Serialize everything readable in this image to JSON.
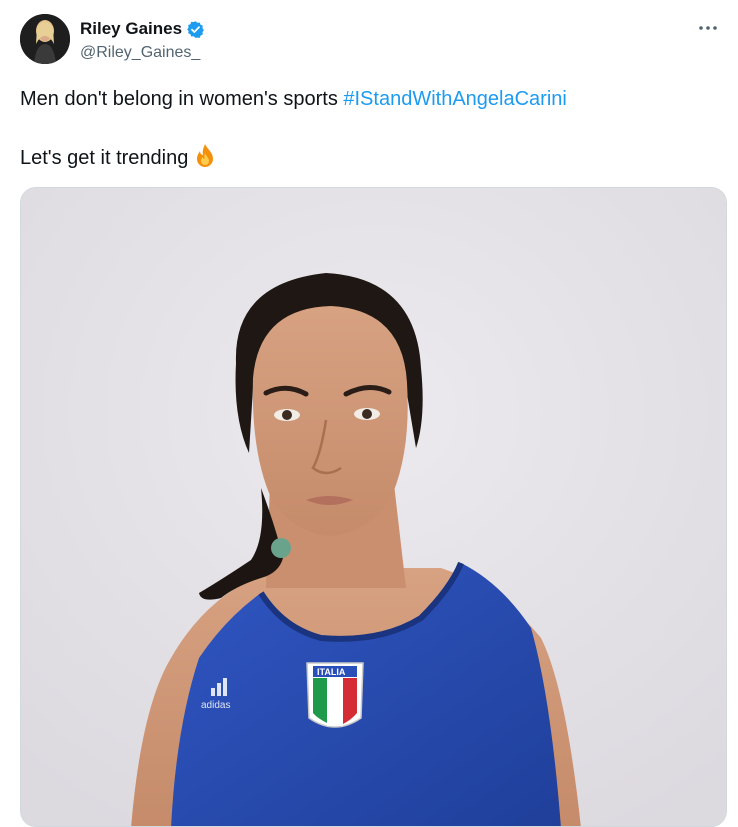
{
  "tweet": {
    "author": {
      "name": "Riley Gaines",
      "handle": "@Riley_Gaines_",
      "verified": true,
      "avatar": "profile-photo"
    },
    "text_prefix": "Men don't belong in women's sports ",
    "hashtag": "#IStandWithAngelaCarini",
    "line2": "Let's get it trending",
    "emoji": "fire-emoji",
    "more_icon": "more-horizontal-icon",
    "media": {
      "type": "photo",
      "description_icon": "athlete-portrait",
      "jersey_logo_text": "adidas",
      "crest_text": "ITALIA"
    }
  },
  "colors": {
    "accent": "#1d9bf0",
    "text": "#0f1419",
    "secondary": "#536471",
    "verified": "#1d9bf0",
    "jersey": "#2a4fb8"
  }
}
